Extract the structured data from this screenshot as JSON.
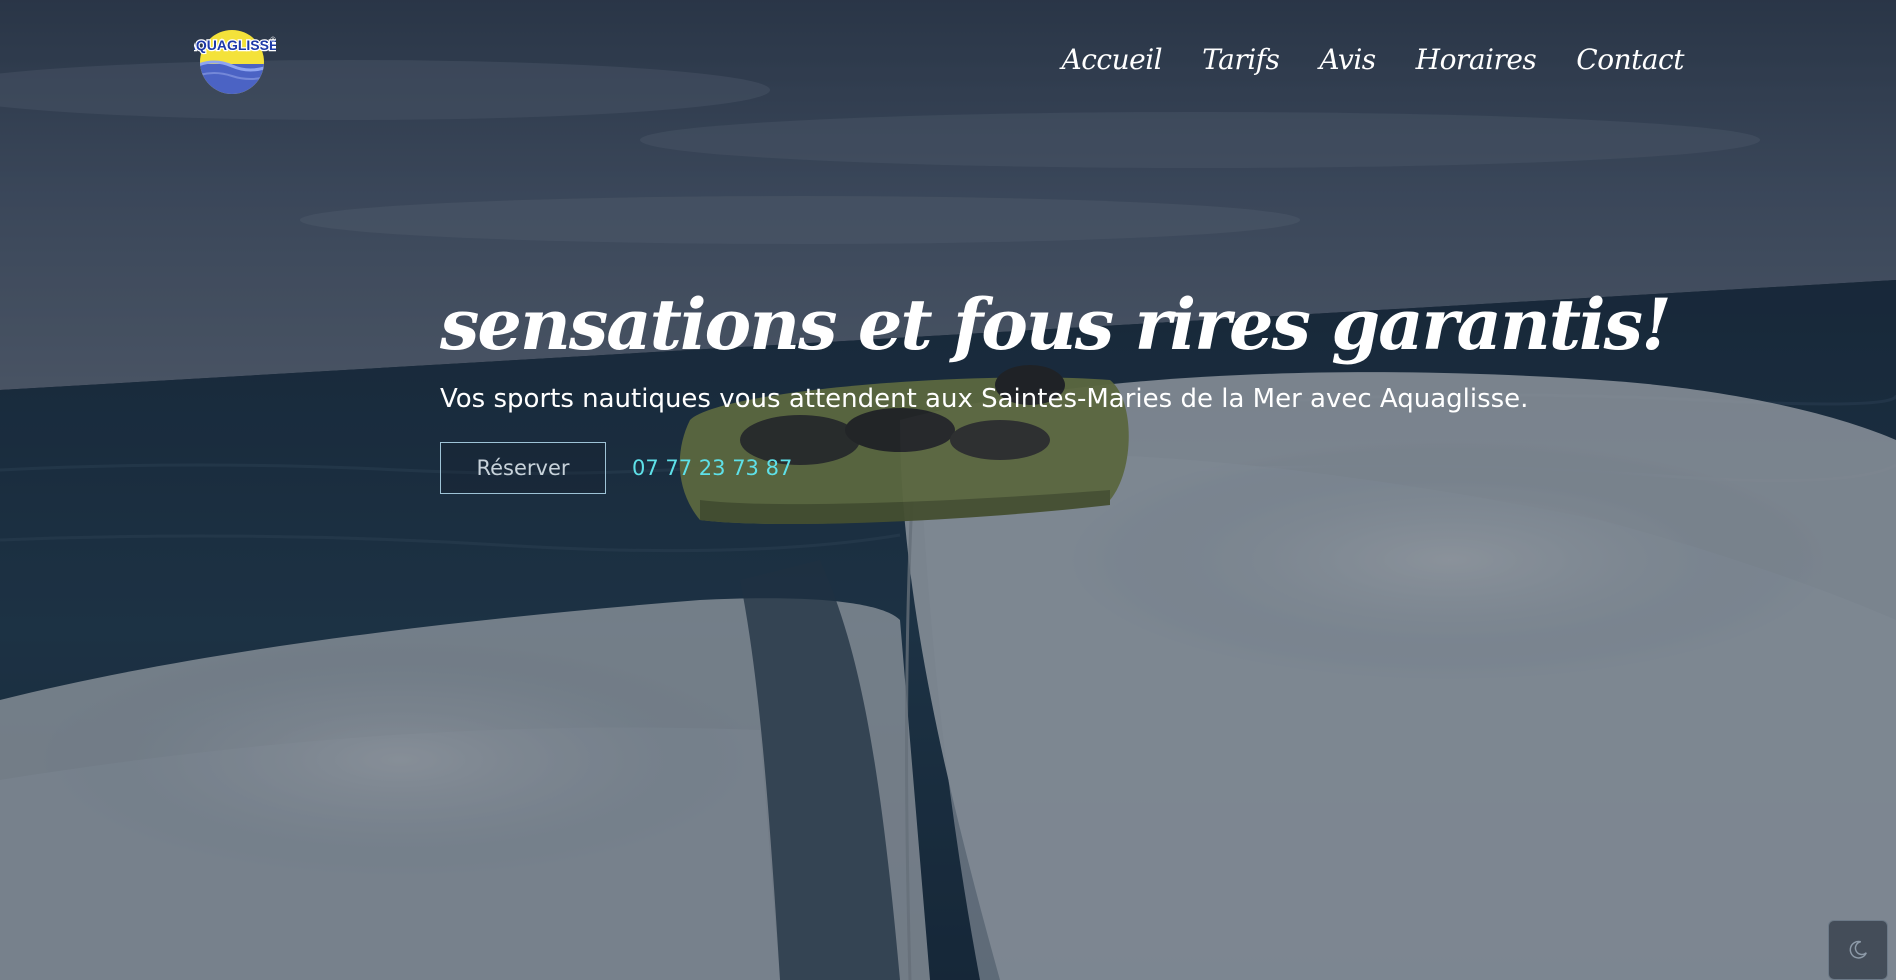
{
  "logo": {
    "text": "AQUAGLISSE",
    "registered": "®",
    "icon": "aquaglisse-logo"
  },
  "nav": {
    "items": [
      {
        "label": "Accueil"
      },
      {
        "label": "Tarifs"
      },
      {
        "label": "Avis"
      },
      {
        "label": "Horaires"
      },
      {
        "label": "Contact"
      }
    ]
  },
  "hero": {
    "title": "sensations et fous rires garantis!",
    "subtitle": "Vos sports nautiques vous attendent aux Saintes-Maries de la Mer avec Aquaglisse.",
    "reserve_label": "Réserver",
    "phone": "07 77 23 73 87"
  },
  "theme_toggle": {
    "icon": "moon-icon"
  },
  "colors": {
    "accent": "#5ee0e8",
    "button_border": "#9ec3d6",
    "text": "#ffffff",
    "logo_yellow": "#f4e23a",
    "logo_blue": "#4b63c4"
  }
}
